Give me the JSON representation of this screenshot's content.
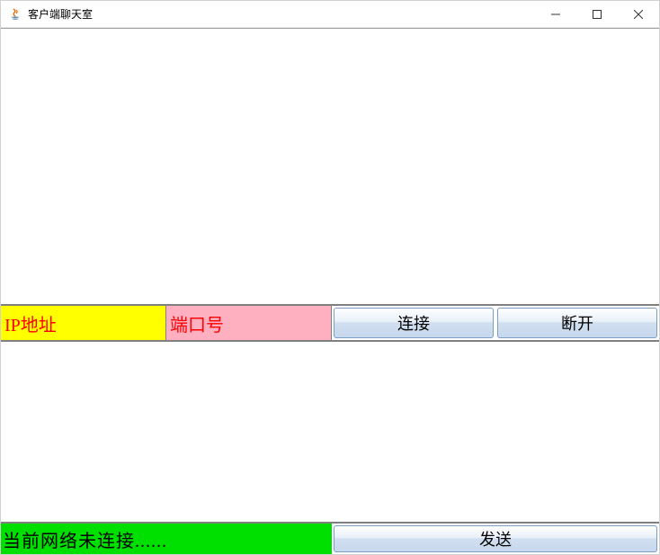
{
  "window": {
    "title": "客户端聊天室"
  },
  "connection": {
    "ip_label": "IP地址",
    "port_label": "端口号",
    "connect_button": "连接",
    "disconnect_button": "断开"
  },
  "status": {
    "text": "当前网络未连接......",
    "send_button": "发送"
  }
}
